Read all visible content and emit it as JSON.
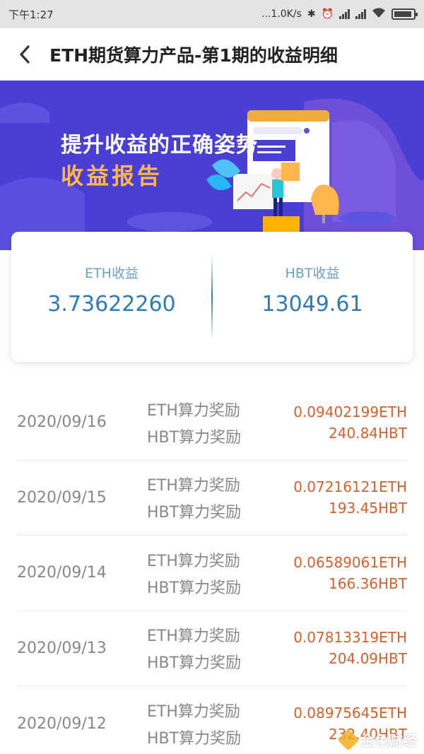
{
  "status_bar": {
    "time": "下午1:27",
    "net_speed": "...1.0K/s"
  },
  "header": {
    "title": "ETH期货算力产品-第1期的收益明细"
  },
  "banner": {
    "line1": "提升收益的正确姿势",
    "line2": "收益报告",
    "colors": {
      "background": "#4a3fd4",
      "accent": "#ffb74d"
    }
  },
  "summary": {
    "eth": {
      "label": "ETH收益",
      "value": "3.73622260"
    },
    "hbt": {
      "label": "HBT收益",
      "value": "13049.61"
    }
  },
  "earnings": [
    {
      "date": "2020/09/16",
      "eth_label": "ETH算力奖励",
      "eth_value": "0.09402199ETH",
      "hbt_label": "HBT算力奖励",
      "hbt_value": "240.84HBT"
    },
    {
      "date": "2020/09/15",
      "eth_label": "ETH算力奖励",
      "eth_value": "0.07216121ETH",
      "hbt_label": "HBT算力奖励",
      "hbt_value": "193.45HBT"
    },
    {
      "date": "2020/09/14",
      "eth_label": "ETH算力奖励",
      "eth_value": "0.06589061ETH",
      "hbt_label": "HBT算力奖励",
      "hbt_value": "166.36HBT"
    },
    {
      "date": "2020/09/13",
      "eth_label": "ETH算力奖励",
      "eth_value": "0.07813319ETH",
      "hbt_label": "HBT算力奖励",
      "hbt_value": "204.09HBT"
    },
    {
      "date": "2020/09/12",
      "eth_label": "ETH算力奖励",
      "eth_value": "0.08975645ETH",
      "hbt_label": "HBT算力奖励",
      "hbt_value": "232.40HBT"
    }
  ],
  "watermark": {
    "text": "金色财经"
  }
}
